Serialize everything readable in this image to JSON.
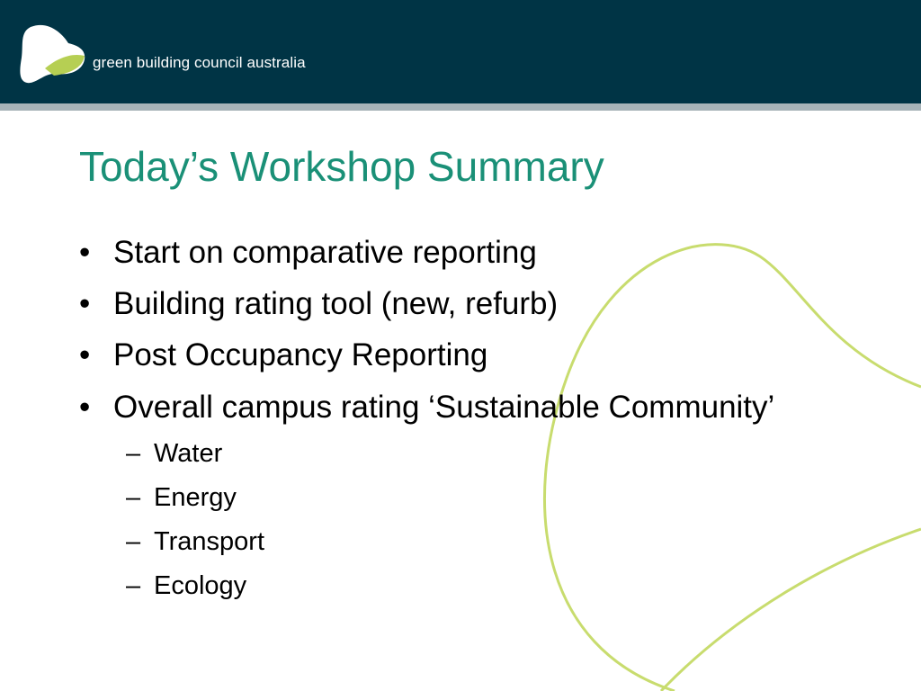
{
  "header": {
    "brand_name": "green building council australia",
    "logo_icon": "leaf-blob-icon",
    "colors": {
      "background": "#003445",
      "rule": "#a7b3b8",
      "logo_white": "#ffffff",
      "logo_green": "#b6cf53"
    }
  },
  "slide": {
    "title": "Today’s Workshop Summary",
    "title_color": "#1a9077",
    "bullets": [
      {
        "marker": "•",
        "text": "Start on comparative reporting"
      },
      {
        "marker": "•",
        "text": "Building rating tool (new, refurb)"
      },
      {
        "marker": "•",
        "text": "Post Occupancy Reporting"
      },
      {
        "marker": "•",
        "text": "Overall campus rating ‘Sustainable Community’"
      }
    ],
    "sub_bullets": [
      {
        "marker": "–",
        "text": "Water"
      },
      {
        "marker": "–",
        "text": "Energy"
      },
      {
        "marker": "–",
        "text": "Transport"
      },
      {
        "marker": "–",
        "text": "Ecology"
      }
    ],
    "decoration_color": "#c8dc6e"
  }
}
